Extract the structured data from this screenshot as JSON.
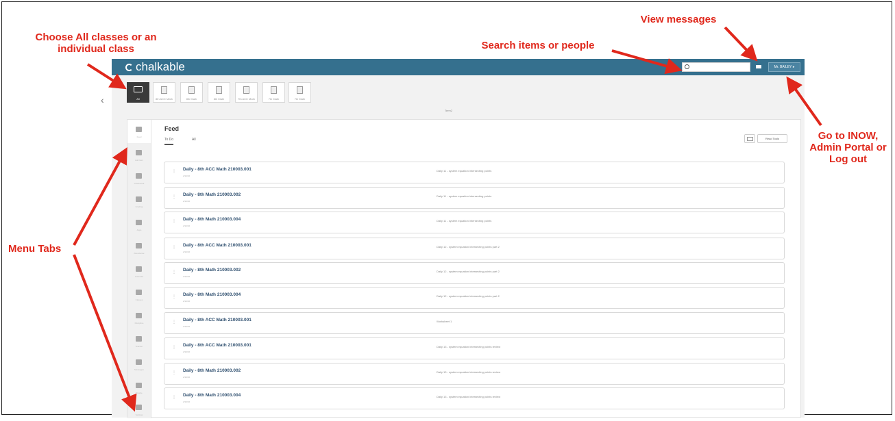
{
  "annotations": {
    "choose_class": "Choose All classes or an individual class",
    "search": "Search items or people",
    "messages": "View messages",
    "inow": "Go to INOW, Admin Portal or Log out",
    "menu_tabs": "Menu Tabs"
  },
  "colors": {
    "topbar": "#35708e",
    "callout": "#e0281c",
    "all_tile": "#3a3a3a"
  },
  "app": {
    "logo_text": "chalkable",
    "user_menu_label": "Mr. BAILEY ▸",
    "term_label": "Term2"
  },
  "class_tiles": [
    {
      "label": "All",
      "icon": "book-icon"
    },
    {
      "label": "8th ACC Math",
      "icon": "calculator-icon"
    },
    {
      "label": "8th Math",
      "icon": "calculator-icon"
    },
    {
      "label": "8th Math",
      "icon": "calculator-icon"
    },
    {
      "label": "7th ACC Math",
      "icon": "calculator-icon"
    },
    {
      "label": "7th Math",
      "icon": "calculator-icon"
    },
    {
      "label": "7th Math",
      "icon": "calculator-icon"
    }
  ],
  "menu_tabs": [
    {
      "label": "Feed",
      "icon": "feed-icon"
    },
    {
      "label": "Add Item",
      "icon": "edit-icon"
    },
    {
      "label": "Gradebook",
      "icon": "gradebook-icon"
    },
    {
      "label": "Grading",
      "icon": "chart-icon"
    },
    {
      "label": "Apps",
      "icon": "apps-icon"
    },
    {
      "label": "Attendance",
      "icon": "attendance-icon"
    },
    {
      "label": "Calendar",
      "icon": "calendar-icon"
    },
    {
      "label": "Classes",
      "icon": "classes-icon"
    },
    {
      "label": "Discipline",
      "icon": "discipline-icon"
    },
    {
      "label": "Teacher",
      "icon": "apple-icon"
    },
    {
      "label": "Messages",
      "icon": "messages-icon"
    },
    {
      "label": "People",
      "icon": "people-icon"
    },
    {
      "label": "Settings",
      "icon": "settings-icon"
    }
  ],
  "feed": {
    "title": "Feed",
    "tabs": [
      "To Do",
      "All"
    ],
    "read_tools_label": "Read Tools",
    "items": [
      {
        "title": "Daily - 8th ACC Math 210003.001",
        "date": "2/13/16",
        "desc": "Daily 11 - system equation intersecting points"
      },
      {
        "title": "Daily - 8th Math 210003.002",
        "date": "2/13/16",
        "desc": "Daily 11 - system equation intersecting points"
      },
      {
        "title": "Daily - 8th Math 210003.004",
        "date": "2/13/16",
        "desc": "Daily 11 - system equation intersecting points"
      },
      {
        "title": "Daily - 8th ACC Math 210003.001",
        "date": "2/13/16",
        "desc": "Daily 12 - system equation intersecting points part 2"
      },
      {
        "title": "Daily - 8th Math 210003.002",
        "date": "2/13/16",
        "desc": "Daily 12 - system equation intersecting points part 2"
      },
      {
        "title": "Daily - 8th Math 210003.004",
        "date": "2/13/16",
        "desc": "Daily 12 - system equation intersecting points part 2"
      },
      {
        "title": "Daily - 8th ACC Math 210003.001",
        "date": "2/15/16",
        "desc": "Worksheet 1"
      },
      {
        "title": "Daily - 8th ACC Math 210003.001",
        "date": "2/16/16",
        "desc": "Daily 13 - system equation intersecting points review"
      },
      {
        "title": "Daily - 8th Math 210003.002",
        "date": "2/16/16",
        "desc": "Daily 13 - system equation intersecting points review"
      },
      {
        "title": "Daily - 8th Math 210003.004",
        "date": "2/16/16",
        "desc": "Daily 13 - system equation intersecting points review"
      }
    ]
  }
}
